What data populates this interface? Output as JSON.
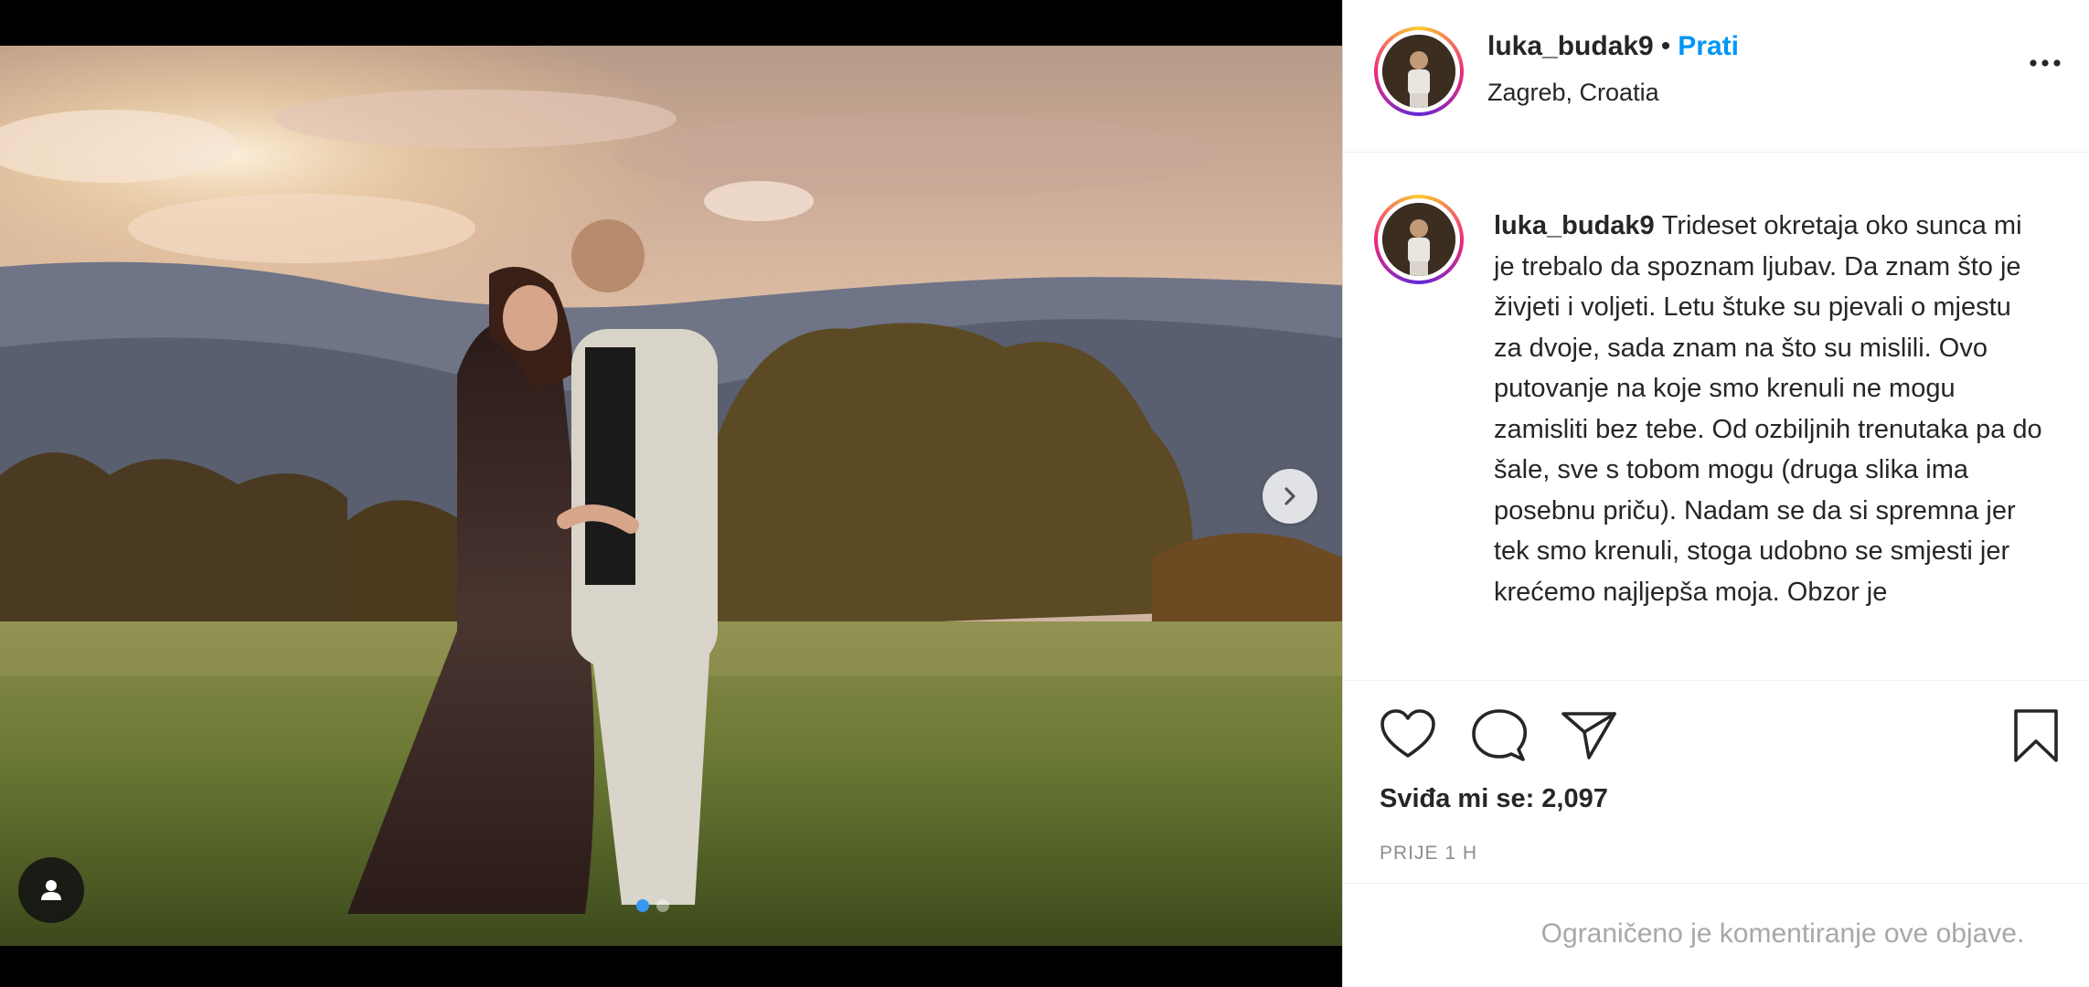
{
  "post": {
    "username": "luka_budak9",
    "follow_label": "Prati",
    "bullet": "•",
    "location": "Zagreb, Croatia",
    "caption": "Trideset okretaja oko sunca mi je trebalo da spoznam ljubav. Da znam što je živjeti i voljeti. Letu štuke su pjevali o mjestu za dvoje, sada znam na što su mislili. Ovo putovanje na koje smo krenuli ne mogu zamisliti bez tebe. Od ozbiljnih trenutaka pa do šale, sve s tobom mogu (druga slika ima posebnu priču). Nadam se da si spremna jer tek smo krenuli, stoga udobno se smjesti jer krećemo najljepša moja. Obzor je",
    "likes_text": "Sviđa mi se: 2,097",
    "time_text": "PRIJE 1 H",
    "comments_disabled_text": "Ograničeno je komentiranje ove objave."
  },
  "carousel": {
    "slide_count": 2,
    "active_index": 0
  },
  "icons": {
    "like": "heart-icon",
    "comment": "comment-icon",
    "share": "paper-plane-icon",
    "save": "bookmark-icon",
    "more": "more-options-icon",
    "next": "chevron-right-icon",
    "tag": "user-tag-icon"
  },
  "colors": {
    "follow": "#0095f6",
    "text": "#262626",
    "muted": "#8e8e8e",
    "active_dot": "#3897f0"
  }
}
